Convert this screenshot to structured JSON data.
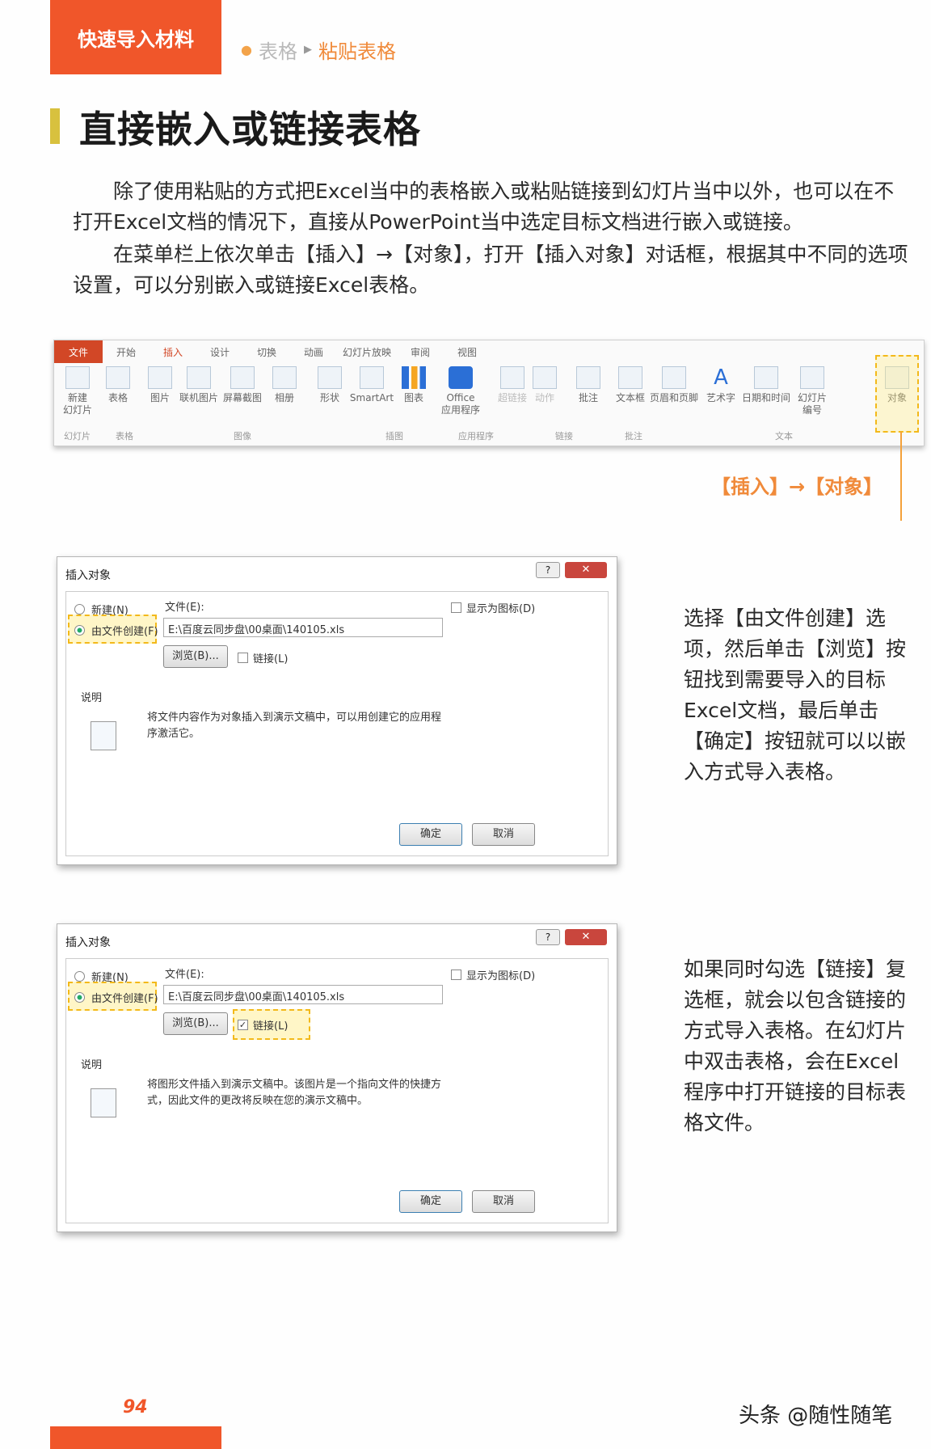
{
  "header": {
    "tag": "快速导入材料",
    "crumb_parent": "表格",
    "crumb_current": "粘贴表格",
    "title": "直接嵌入或链接表格"
  },
  "intro": {
    "p1": "除了使用粘贴的方式把Excel当中的表格嵌入或粘贴链接到幻灯片当中以外，也可以在不打开Excel文档的情况下，直接从PowerPoint当中选定目标文档进行嵌入或链接。",
    "p2": "在菜单栏上依次单击【插入】→【对象】，打开【插入对象】对话框，根据其中不同的选项设置，可以分别嵌入或链接Excel表格。"
  },
  "ribbon": {
    "tabs": [
      "文件",
      "开始",
      "插入",
      "设计",
      "切换",
      "动画",
      "幻灯片放映",
      "审阅",
      "视图"
    ],
    "tools": [
      "新建\n幻灯片",
      "表格",
      "图片",
      "联机图片",
      "屏幕截图",
      "相册",
      "形状",
      "SmartArt",
      "图表",
      "Office\n应用程序",
      "超链接",
      "动作",
      "批注",
      "文本框",
      "页眉和页脚",
      "艺术字",
      "日期和时间",
      "幻灯片\n编号",
      "对象"
    ],
    "groups": [
      "幻灯片",
      "表格",
      "图像",
      "插图",
      "应用程序",
      "链接",
      "批注",
      "文本"
    ],
    "callout": "【插入】→【对象】"
  },
  "dialog1": {
    "title": "插入对象",
    "close": "✕",
    "help": "?",
    "opt_new": "新建(N)",
    "opt_file": "由文件创建(F)",
    "file_label": "文件(E):",
    "file_path": "E:\\百度云同步盘\\00桌面\\140105.xls",
    "browse": "浏览(B)...",
    "link": "链接(L)",
    "show_icon": "显示为图标(D)",
    "section": "说明",
    "description": "将文件内容作为对象插入到演示文稿中，可以用创建它的应用程序激活它。",
    "ok": "确定",
    "cancel": "取消"
  },
  "dialog2": {
    "title": "插入对象",
    "close": "✕",
    "help": "?",
    "opt_new": "新建(N)",
    "opt_file": "由文件创建(F)",
    "file_label": "文件(E):",
    "file_path": "E:\\百度云同步盘\\00桌面\\140105.xls",
    "browse": "浏览(B)...",
    "link": "链接(L)",
    "show_icon": "显示为图标(D)",
    "section": "说明",
    "description": "将图形文件插入到演示文稿中。该图片是一个指向文件的快捷方式，因此文件的更改将反映在您的演示文稿中。",
    "ok": "确定",
    "cancel": "取消"
  },
  "side1": "选择【由文件创建】选项，然后单击【浏览】按钮找到需要导入的目标Excel文档，最后单击【确定】按钮就可以以嵌入方式导入表格。",
  "side2": "如果同时勾选【链接】复选框，就会以包含链接的方式导入表格。在幻灯片中双击表格，会在Excel程序中打开链接的目标表格文件。",
  "footer": {
    "page_number": "94",
    "watermark": "头条 @随性随笔"
  },
  "colors": {
    "accent_orange": "#f0562a",
    "highlight_yellow": "#f3b91a",
    "title_bar": "#d8c13e"
  }
}
